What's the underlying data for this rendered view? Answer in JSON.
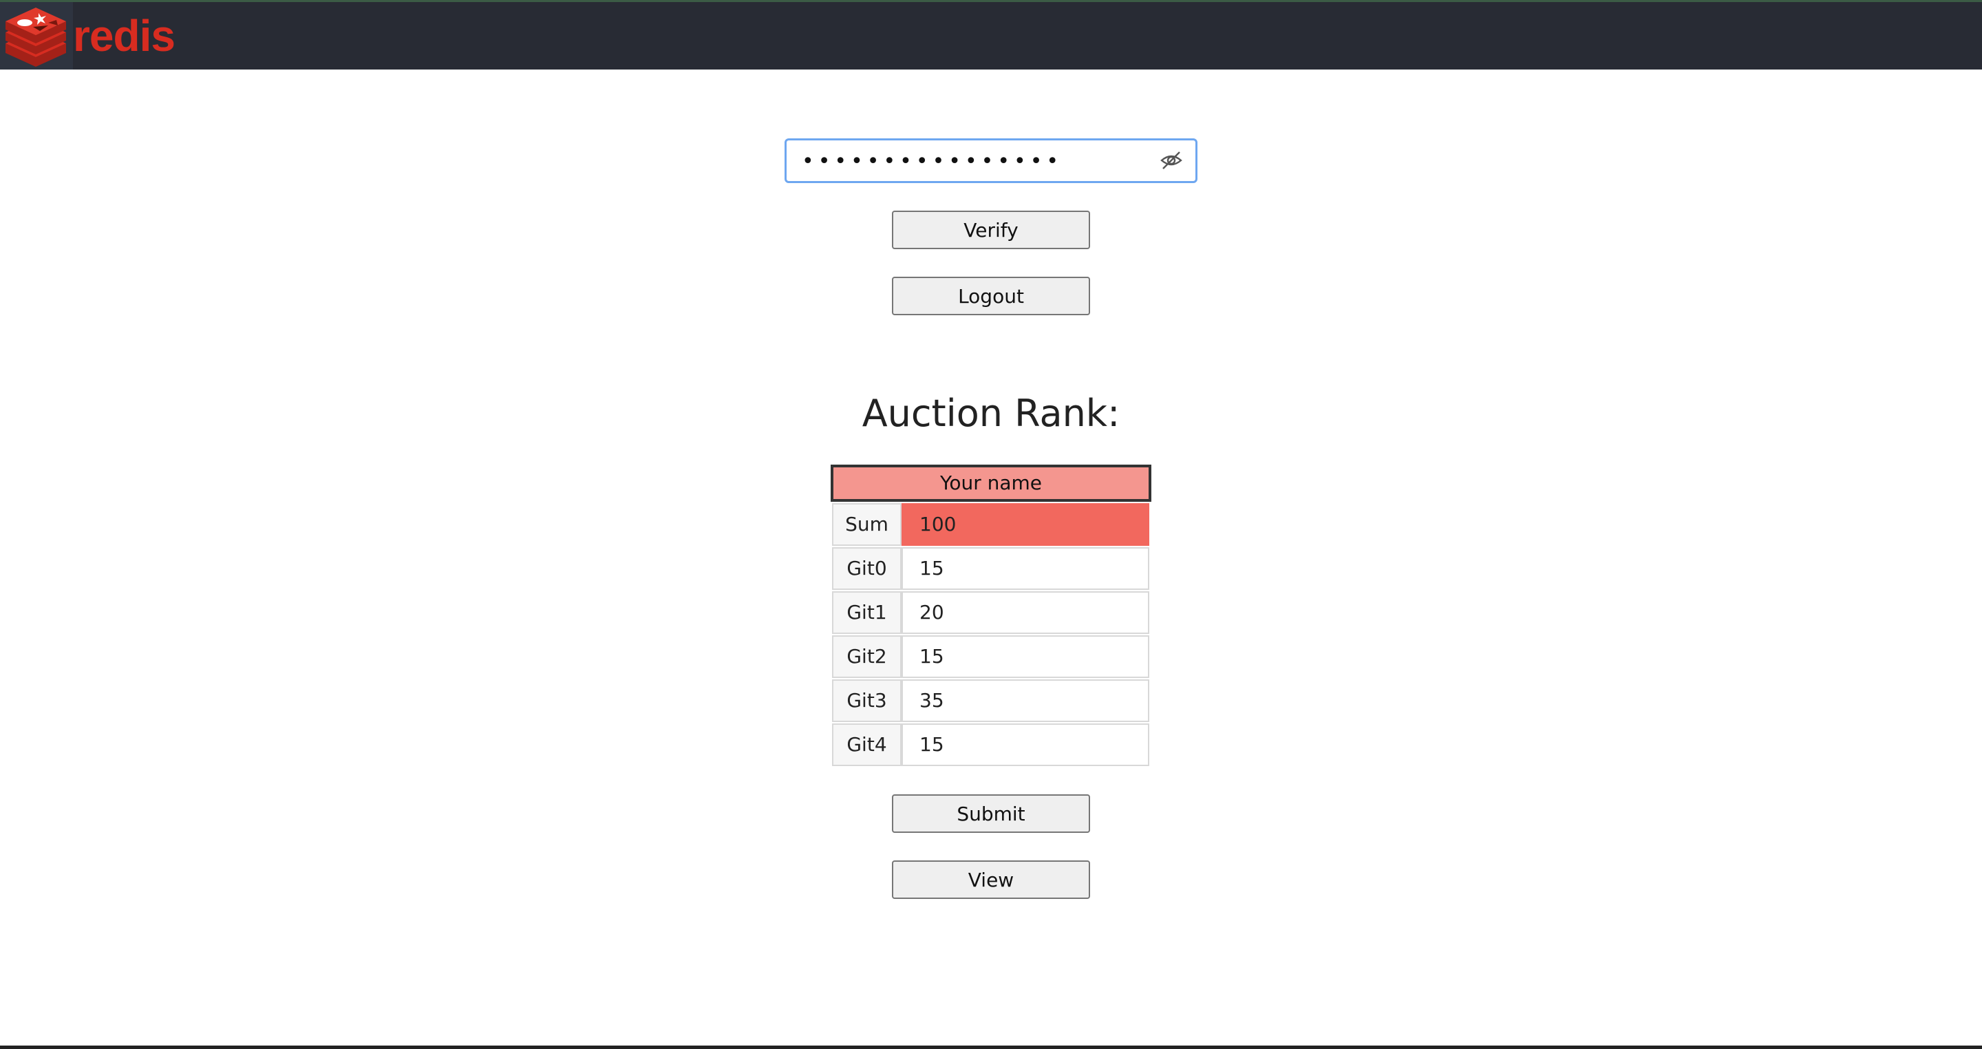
{
  "header": {
    "logo_text": "redis",
    "brand_color": "#d82c20"
  },
  "password": {
    "masked_value": "••••••••••••••••",
    "visibility_icon": "eye-slash-icon"
  },
  "buttons": {
    "verify": "Verify",
    "logout": "Logout",
    "submit": "Submit",
    "view": "View"
  },
  "auction": {
    "title": "Auction Rank:",
    "name_placeholder": "Your name",
    "sum_label": "Sum",
    "sum_value": "100",
    "rows": [
      {
        "label": "Git0",
        "value": "15"
      },
      {
        "label": "Git1",
        "value": "20"
      },
      {
        "label": "Git2",
        "value": "15"
      },
      {
        "label": "Git3",
        "value": "35"
      },
      {
        "label": "Git4",
        "value": "15"
      }
    ],
    "name_color": "#f4968f",
    "sum_color": "#f2685e"
  }
}
